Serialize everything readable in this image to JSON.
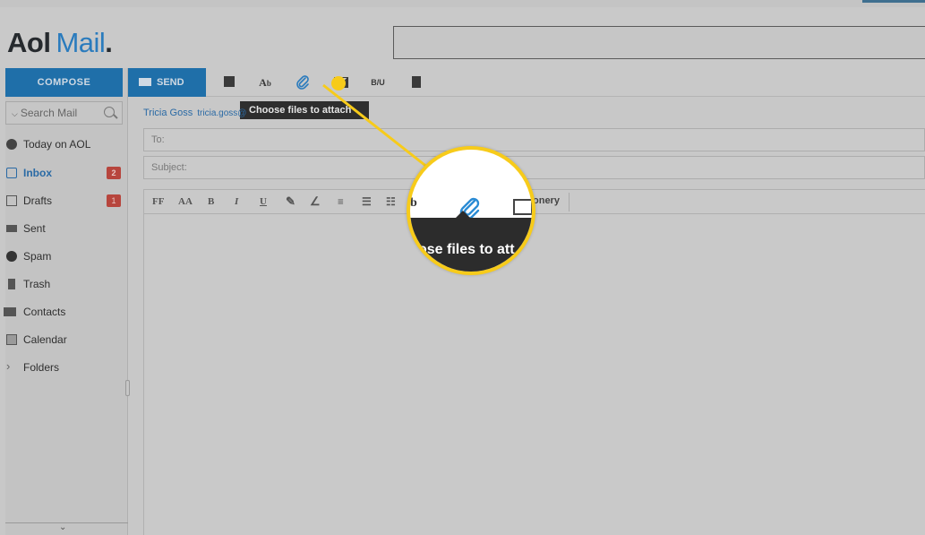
{
  "header": {
    "logo_aol": "Aol",
    "logo_mail": "Mail",
    "logo_dot": "."
  },
  "sidebar": {
    "compose_label": "COMPOSE",
    "search_placeholder": "Search Mail",
    "items": [
      {
        "label": "Today on AOL",
        "icon": "aol-icon",
        "badge": ""
      },
      {
        "label": "Inbox",
        "icon": "inbox-icon",
        "badge": "2",
        "active": true
      },
      {
        "label": "Drafts",
        "icon": "drafts-icon",
        "badge": "1"
      },
      {
        "label": "Sent",
        "icon": "sent-icon",
        "badge": ""
      },
      {
        "label": "Spam",
        "icon": "spam-icon",
        "badge": ""
      },
      {
        "label": "Trash",
        "icon": "trash-icon",
        "badge": ""
      },
      {
        "label": "Contacts",
        "icon": "contacts-icon",
        "badge": ""
      },
      {
        "label": "Calendar",
        "icon": "calendar-icon",
        "badge": ""
      },
      {
        "label": "Folders",
        "icon": "chevron-right-icon",
        "badge": ""
      }
    ]
  },
  "toolbar": {
    "send_label": "SEND",
    "icons": [
      "save-icon",
      "spellcheck-icon",
      "attach-icon",
      "insert-image-icon",
      "text-format-icon",
      "delete-icon"
    ],
    "tooltip": "Choose files to attach"
  },
  "compose": {
    "from_name": "Tricia Goss",
    "from_email": "tricia.goss@",
    "to_placeholder": "To:",
    "subject_placeholder": "Subject:"
  },
  "format_bar": {
    "items": [
      "FF",
      "AA",
      "B",
      "I",
      "U"
    ]
  },
  "magnifier": {
    "tooltip_partial": "ose files to att",
    "stationery_partial": "onery"
  },
  "colors": {
    "accent": "#1f6fa9",
    "highlight": "#f7cb1a",
    "badge": "#b7453d"
  }
}
